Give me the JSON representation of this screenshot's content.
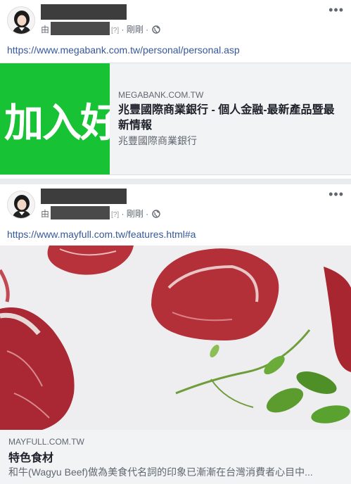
{
  "posts": [
    {
      "by": "由",
      "unknown": "[?]",
      "time": "· 剛剛 ·",
      "more": "•••",
      "url": "https://www.megabank.com.tw/personal/personal.asp",
      "card": {
        "image_text": "加入好",
        "domain": "MEGABANK.COM.TW",
        "title": "兆豐國際商業銀行 - 個人金融-最新產品暨最新情報",
        "description": "兆豐國際商業銀行"
      }
    },
    {
      "by": "由",
      "unknown": "[?]",
      "time": "· 剛剛 ·",
      "more": "•••",
      "url": "https://www.mayfull.com.tw/features.html#a",
      "card": {
        "domain": "MAYFULL.COM.TW",
        "title": "特色食材",
        "description": "和牛(Wagyu Beef)做為美食代名詞的印象已漸漸在台灣消費者心目中..."
      }
    }
  ]
}
